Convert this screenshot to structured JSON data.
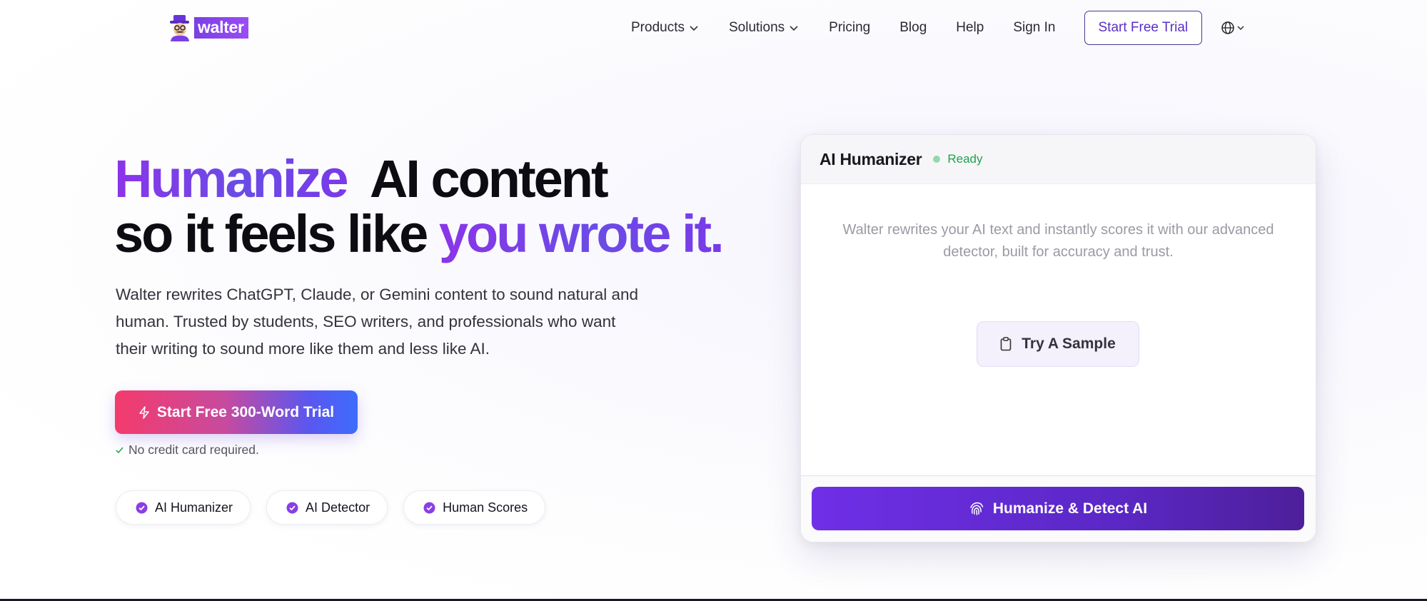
{
  "brand": {
    "name": "walter",
    "accent": "#7b3fe4"
  },
  "nav": {
    "items": [
      {
        "label": "Products",
        "dropdown": true
      },
      {
        "label": "Solutions",
        "dropdown": true
      },
      {
        "label": "Pricing"
      },
      {
        "label": "Blog"
      },
      {
        "label": "Help"
      },
      {
        "label": "Sign In"
      }
    ],
    "cta_label": "Start Free Trial",
    "language_icon": "globe-icon"
  },
  "hero": {
    "title_line1_gradient": "Humanize",
    "title_line1_rest": "AI content",
    "title_line2_plain": "so it feels like",
    "title_line2_gradient": "you wrote it.",
    "subtitle": "Walter rewrites ChatGPT, Claude, or Gemini content to sound natural and human. Trusted by students, SEO writers, and professionals who want their writing to sound more like them and less like AI.",
    "cta_label": "Start Free 300-Word Trial",
    "cta_icon": "lightning-icon",
    "note": "No credit card required.",
    "features": [
      "AI Humanizer",
      "AI Detector",
      "Human Scores"
    ]
  },
  "tool_card": {
    "title": "AI Humanizer",
    "status": "Ready",
    "status_color": "#1fa34d",
    "description": "Walter rewrites your AI text and instantly scores it with our advanced detector, built for accuracy and trust.",
    "sample_label": "Try A Sample",
    "sample_icon": "clipboard-icon",
    "action_label": "Humanize & Detect AI",
    "action_icon": "fingerprint-icon"
  }
}
